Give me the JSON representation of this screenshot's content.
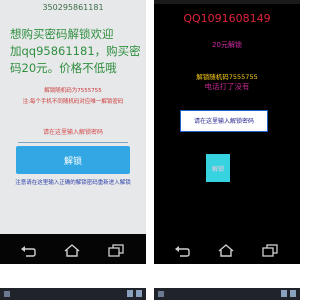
{
  "left_phone": {
    "top_text": "350295861181",
    "paragraph_lines": [
      "想购买密码解锁欢迎",
      "加qq95861181，购买密",
      "码20元。价格不低哦"
    ],
    "hint_1": "解锁随机码为7555755",
    "hint_2": "注:每个手机不同随机码对应唯一解锁密码",
    "input_placeholder": "请在这里输入解锁密码",
    "button_label": "解锁",
    "bottom_link": "注意请在这里输入正确的解锁密码重新进入解锁"
  },
  "right_phone": {
    "qq_text": "QQ1091608149",
    "sub_text": "20元解锁",
    "code_line_1": "解锁随机码7555755",
    "code_line_2": "电话打了没有",
    "input_placeholder": "请在这里输入解锁密码",
    "button_label": "解锁"
  },
  "nav": {
    "icons": [
      "back-icon",
      "home-icon",
      "recent-apps-icon"
    ]
  },
  "colors": {
    "left_background": "#e7e8ea",
    "left_paragraph": "#2f8f3f",
    "left_button": "#33a7e4",
    "right_background": "#000000",
    "right_qq": "#e0243a",
    "right_code": "#ffd21a",
    "right_button": "#38d3e0"
  }
}
